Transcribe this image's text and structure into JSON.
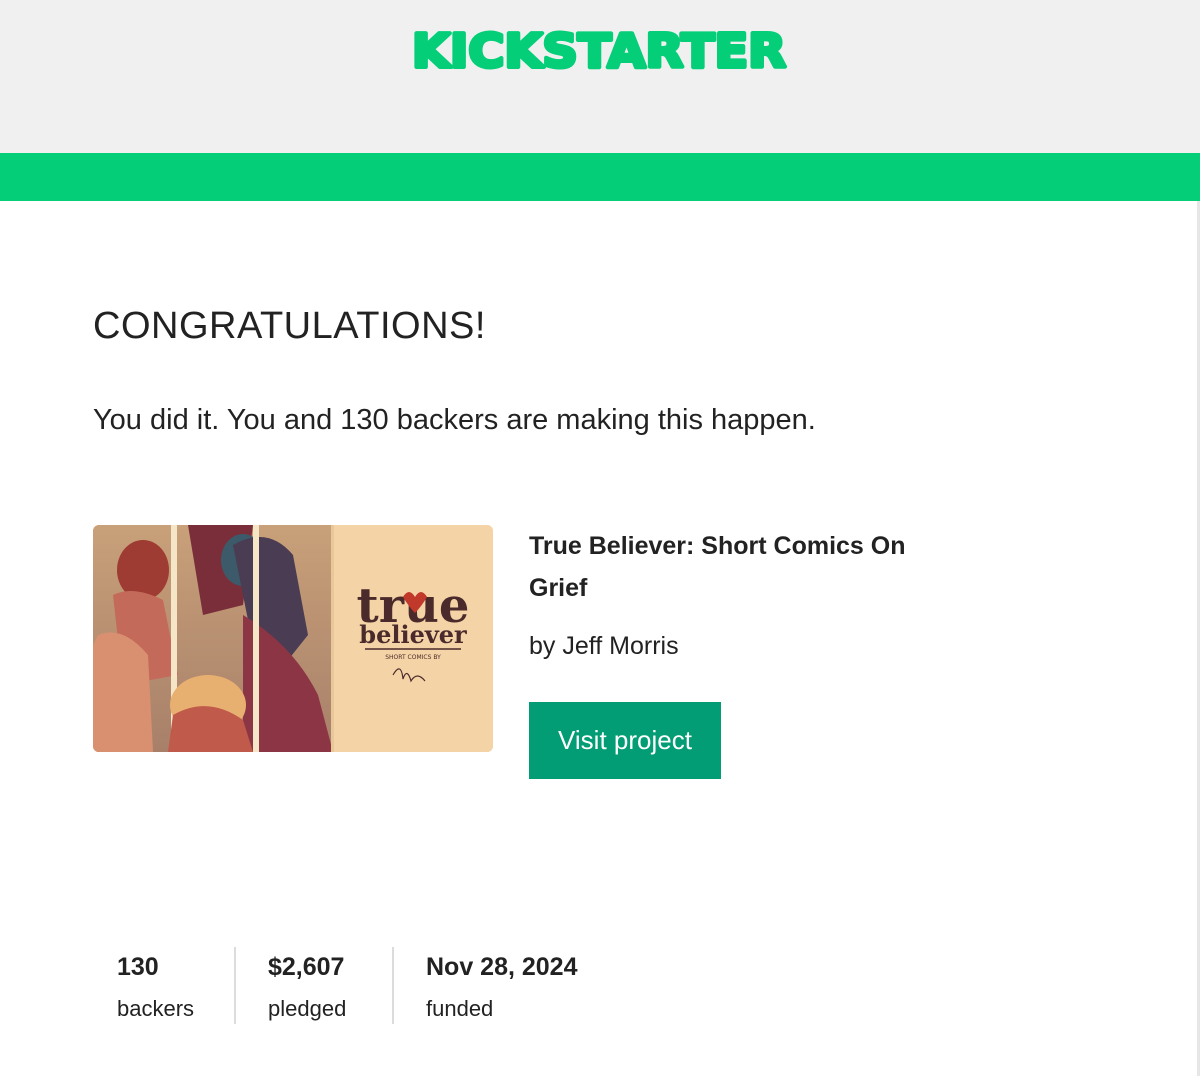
{
  "brand": {
    "logo_text": "KICKSTARTER",
    "logo_color": "#05ce78",
    "bar_color": "#05ce78",
    "button_color": "#029d74"
  },
  "message": {
    "headline": "CONGRATULATIONS!",
    "subline": "You did it. You and 130 backers are making this happen."
  },
  "project": {
    "image_alt": "true believer cover art",
    "cover_title_line1": "true",
    "cover_title_line2": "believer",
    "cover_subtitle": "SHORT COMICS BY",
    "title": "True Believer: Short Comics On Grief",
    "creator": "by Jeff Morris",
    "visit_label": "Visit project"
  },
  "stats": [
    {
      "value": "130",
      "label": "backers"
    },
    {
      "value": "$2,607",
      "label": "pledged"
    },
    {
      "value": "Nov 28, 2024",
      "label": "funded"
    }
  ]
}
